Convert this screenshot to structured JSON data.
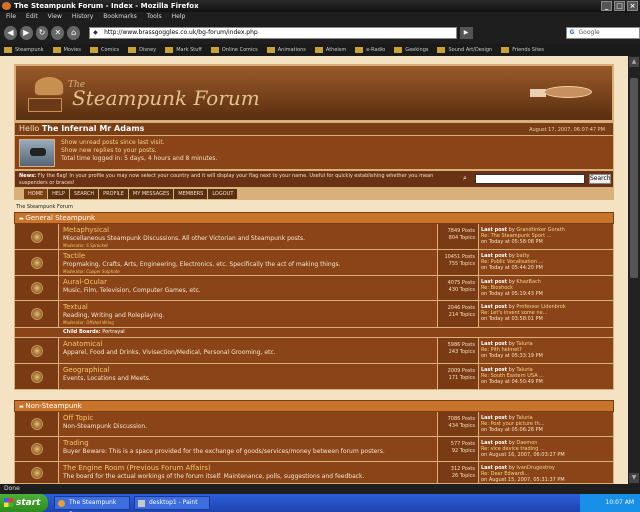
{
  "browser": {
    "window_title": "The Steampunk Forum - Index - Mozilla Firefox",
    "menu": [
      "File",
      "Edit",
      "View",
      "History",
      "Bookmarks",
      "Tools",
      "Help"
    ],
    "url": "http://www.brassgoggles.co.uk/bg-forum/index.php",
    "search_placeholder": "Google",
    "bookmarks": [
      "Steampunk",
      "Movies",
      "Comics",
      "Disney",
      "Mark Stuff",
      "Online Comics",
      "Animations",
      "Atheism",
      "e-Radio",
      "Geekings",
      "Sound Art/Design",
      "Friends Sites"
    ],
    "status": "Done"
  },
  "forum": {
    "title_prefix": "The",
    "title": "Steampunk Forum",
    "hello_prefix": "Hello",
    "username": "The Infernal Mr Adams",
    "date": "August 17, 2007, 06:07:47 PM",
    "user_lines": [
      "Show unread posts since last visit.",
      "Show new replies to your posts.",
      "Total time logged in: 5 days, 4 hours and 8 minutes."
    ],
    "news_label": "News:",
    "news_text": "Fly the flag! In your profile you may now select your country and it will display your flag next to your name. Useful for quickly establishing whether you mean suspenders or braces!",
    "search_button": "Search",
    "tabs": [
      "HOME",
      "HELP",
      "SEARCH",
      "PROFILE",
      "MY MESSAGES",
      "MEMBERS",
      "LOGOUT"
    ],
    "breadcrumb": "The Steampunk Forum",
    "categories": [
      {
        "name": "General Steampunk"
      },
      {
        "name": "Non-Steampunk"
      }
    ],
    "boards": [
      {
        "name": "Metaphysical",
        "desc": "Miscellaneous Steampunk Discussions. All other Victorian and Steampunk posts.",
        "mod": "Moderator: S Sprocket",
        "posts": "7849 Posts",
        "topics": "804 Topics",
        "last_by": "Grandtinker Gorath",
        "last_in": "Re: The Steampunk Sport ...",
        "last_on": "on Today at 05:58:08 PM"
      },
      {
        "name": "Tactile",
        "desc": "Propmaking, Crafts, Arts, Engineering, Electronics, etc. Specifically the act of making things.",
        "mod": "Moderator: Copper Sulphate",
        "posts": "10451 Posts",
        "topics": "755 Topics",
        "last_by": "batty",
        "last_in": "Re: Public Vocalisation ...",
        "last_on": "on Today at 05:44:20 PM"
      },
      {
        "name": "Aural-Ocular",
        "desc": "Music, Film, Television, Computer Games, etc.",
        "mod": "",
        "posts": "4075 Posts",
        "topics": "430 Topics",
        "last_by": "KhazBach",
        "last_in": "Re: Bioshock",
        "last_on": "on Today at 05:19:43 PM"
      },
      {
        "name": "Textual",
        "desc": "Reading, Writing and Roleplaying.",
        "mod": "Moderator: Offsted Wring",
        "posts": "2046 Posts",
        "topics": "214 Topics",
        "last_by": "Professor Lidenbrok",
        "last_in": "Re: Let's invent some ne...",
        "last_on": "on Today at 03:58:01 PM"
      },
      {
        "name": "Anatomical",
        "desc": "Apparel, Food and Drinks, Vivisection/Medical, Personal Grooming, etc.",
        "mod": "",
        "posts": "5986 Posts",
        "topics": "243 Topics",
        "last_by": "Taluria",
        "last_in": "Re: Pith helmet?",
        "last_on": "on Today at 05:33:19 PM"
      },
      {
        "name": "Geographical",
        "desc": "Events, Locations and Meets.",
        "mod": "",
        "posts": "2009 Posts",
        "topics": "171 Topics",
        "last_by": "Taluria",
        "last_in": "Re: South Eastern USA ...",
        "last_on": "on Today at 04:50:49 PM"
      },
      {
        "name": "Off Topic",
        "desc": "Non-Steampunk Discussion.",
        "mod": "",
        "posts": "7086 Posts",
        "topics": "434 Topics",
        "last_by": "Taluria",
        "last_in": "Re: Post your picture th...",
        "last_on": "on Today at 05:06:28 PM"
      },
      {
        "name": "Trading",
        "desc": "Buyer Beware: This is a space provided for the exchange of goods/services/money between forum posters.",
        "mod": "",
        "posts": "577 Posts",
        "topics": "92 Topics",
        "last_by": "Daemon",
        "last_in": "Re: vice device trading ...",
        "last_on": "on August 16, 2007, 06:03:27 PM"
      },
      {
        "name": "The Engine Room (Previous Forum Affairs)",
        "desc": "The board for the actual workings of the forum itself. Maintenance, polls, suggestions and feedback.",
        "mod": "",
        "posts": "312 Posts",
        "topics": "26 Topics",
        "last_by": "IvanDrugostroy",
        "last_in": "Re: Dear Edwardi...",
        "last_on": "on August 15, 2007, 05:31:37 PM"
      }
    ],
    "child_boards_label": "Child Boards:",
    "child_board": "Portrayal",
    "last_post_label": "Last post",
    "by_label": "by"
  },
  "taskbar": {
    "start": "start",
    "tasks": [
      "The Steampunk Forum...",
      "desktop1 - Paint"
    ],
    "clock": "10:07 AM"
  }
}
